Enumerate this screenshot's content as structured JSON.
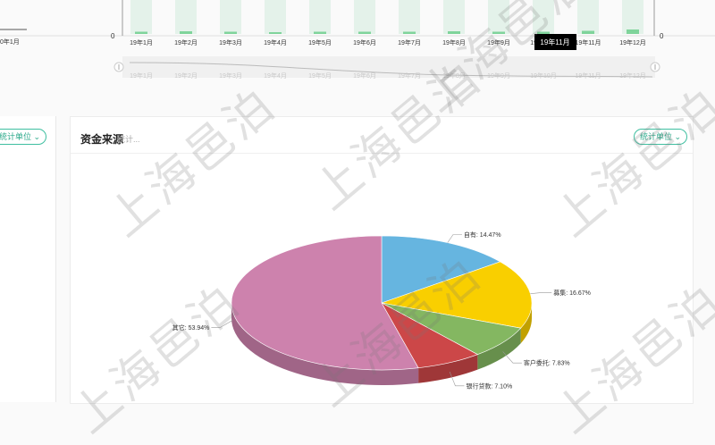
{
  "top_chart": {
    "months": [
      "19年1月",
      "19年2月",
      "19年3月",
      "19年4月",
      "19年5月",
      "19年6月",
      "19年7月",
      "19年8月",
      "19年9月",
      "19年10月",
      "19年11月",
      "19年12月"
    ],
    "left_tick_fragment": "0年1月",
    "y_zero_left": "0",
    "y_zero_right": "0",
    "tooltip": "19年11月",
    "bar_values": [
      0.1,
      0.12,
      0.1,
      0.08,
      0.1,
      0.1,
      0.1,
      0.12,
      0.1,
      0.1,
      0.14,
      0.2
    ]
  },
  "left_panel": {
    "unit_button": "统计单位"
  },
  "card": {
    "title": "资金来源",
    "subtitle": "统计...",
    "unit_button": "统计单位"
  },
  "chart_data": {
    "type": "pie",
    "title": "资金来源",
    "slices": [
      {
        "label": "自有",
        "value": 14.47,
        "color": "#66b5e0"
      },
      {
        "label": "募集",
        "value": 16.67,
        "color": "#f9cf00"
      },
      {
        "label": "客户委托",
        "value": 7.83,
        "color": "#84b761"
      },
      {
        "label": "银行贷款",
        "value": 7.1,
        "color": "#cc4748"
      },
      {
        "label": "其它",
        "value": 53.94,
        "color": "#cd82ad"
      }
    ],
    "labels_text": [
      "自有: 14.47%",
      "募集: 16.67%",
      "客户委托: 7.83%",
      "银行贷款: 7.10%",
      "其它: 53.94%"
    ]
  },
  "watermark": "上海邑泊",
  "icons": {
    "unit_chevron": "chevron-down-icon",
    "slider_handle": "slider-handle-icon"
  }
}
